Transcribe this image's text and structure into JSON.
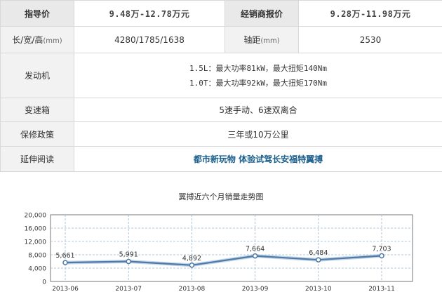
{
  "table": {
    "row1": {
      "label1": "指导价",
      "value1": "9.48万-12.78万元",
      "label2": "经销商报价",
      "value2": "9.28万-11.98万元"
    },
    "row2": {
      "label1": "长/宽/高",
      "unit1": "(mm)",
      "value1": "4280/1785/1638",
      "label2": "轴距",
      "unit2": "(mm)",
      "value2": "2530"
    },
    "engine": {
      "label": "发动机",
      "line1": "1.5L：最大功率81kW，最大扭矩140Nm",
      "line2": "1.0T：最大功率92kW，最大扭矩170Nm"
    },
    "gearbox": {
      "label": "变速箱",
      "value": "5速手动、6速双离合"
    },
    "warranty": {
      "label": "保修政策",
      "value": "三年或10万公里"
    },
    "reading": {
      "label": "延伸阅读",
      "link": "都市新玩物 体验试驾长安福特翼搏"
    }
  },
  "chart_data": {
    "type": "line",
    "title": "翼搏近六个月销量走势图",
    "categories": [
      "2013-06",
      "2013-07",
      "2013-08",
      "2013-09",
      "2013-10",
      "2013-11"
    ],
    "series": [
      {
        "values": [
          5661,
          5991,
          4892,
          7664,
          6484,
          7703
        ]
      }
    ],
    "value_labels": [
      "5,661",
      "5,991",
      "4,892",
      "7,664",
      "6,484",
      "7,703"
    ],
    "yticks": [
      "0",
      "4,000",
      "8,000",
      "12,000",
      "16,000",
      "20,000"
    ],
    "ylim": [
      0,
      20000
    ],
    "grid": true,
    "line_color": "#4f79a7",
    "marker_color": "#ffffff",
    "xlabel": "",
    "ylabel": ""
  }
}
